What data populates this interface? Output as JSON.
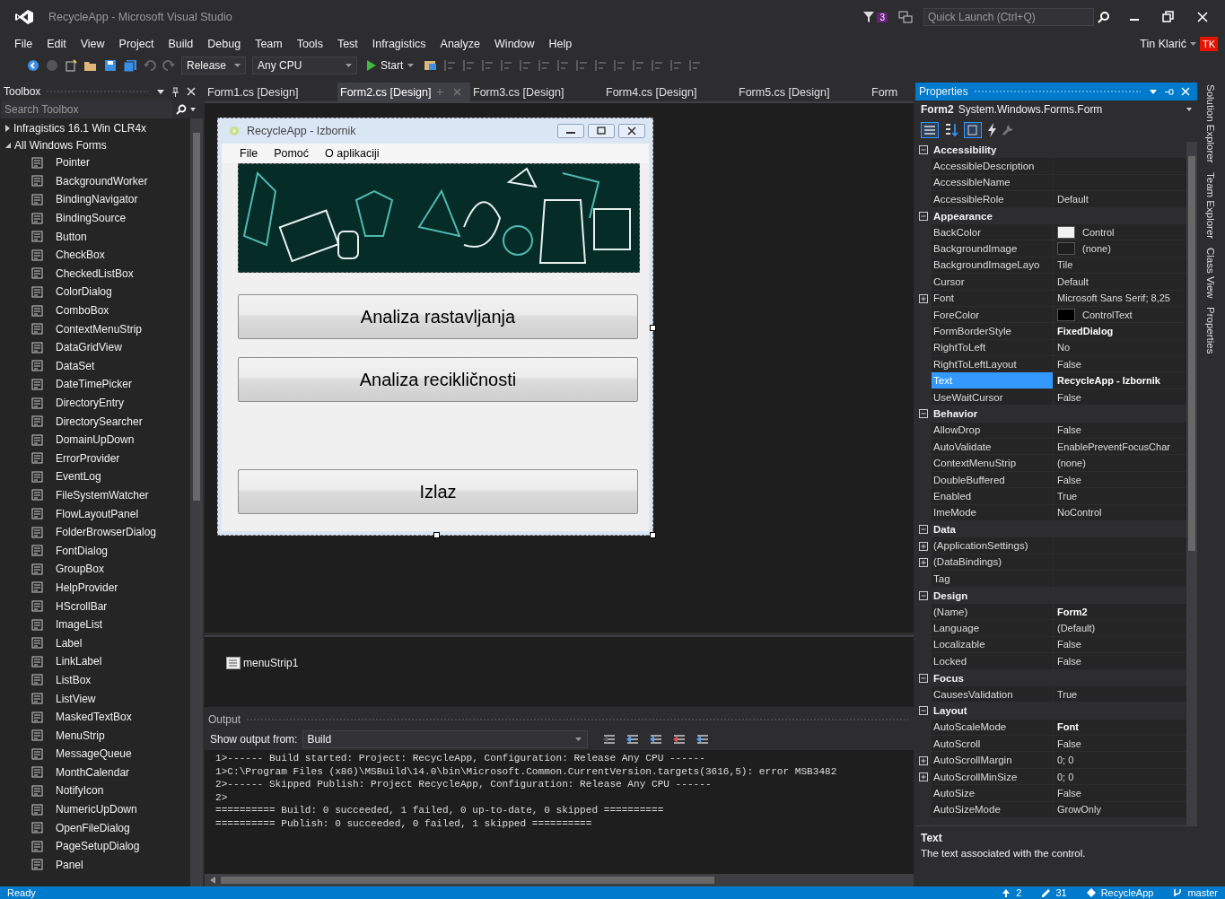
{
  "window": {
    "title": "RecycleApp - Microsoft Visual Studio",
    "notification_count": "3",
    "quick_launch": {
      "placeholder": "Quick Launch (Ctrl+Q)"
    },
    "user_name": "Tin Klarić",
    "user_initials": "TK"
  },
  "menu": [
    "File",
    "Edit",
    "View",
    "Project",
    "Build",
    "Debug",
    "Team",
    "Tools",
    "Test",
    "Infragistics",
    "Analyze",
    "Window",
    "Help"
  ],
  "toolbar": {
    "configuration": "Release",
    "platform": "Any CPU",
    "start": "Start"
  },
  "toolbox": {
    "title": "Toolbox",
    "search": {
      "placeholder": "Search Toolbox"
    },
    "groups": [
      {
        "label": "Infragistics 16.1 Win CLR4x",
        "expanded": false
      },
      {
        "label": "All Windows Forms",
        "expanded": true,
        "children": [
          "Pointer",
          "BackgroundWorker",
          "BindingNavigator",
          "BindingSource",
          "Button",
          "CheckBox",
          "CheckedListBox",
          "ColorDialog",
          "ComboBox",
          "ContextMenuStrip",
          "DataGridView",
          "DataSet",
          "DateTimePicker",
          "DirectoryEntry",
          "DirectorySearcher",
          "DomainUpDown",
          "ErrorProvider",
          "EventLog",
          "FileSystemWatcher",
          "FlowLayoutPanel",
          "FolderBrowserDialog",
          "FontDialog",
          "GroupBox",
          "HelpProvider",
          "HScrollBar",
          "ImageList",
          "Label",
          "LinkLabel",
          "ListBox",
          "ListView",
          "MaskedTextBox",
          "MenuStrip",
          "MessageQueue",
          "MonthCalendar",
          "NotifyIcon",
          "NumericUpDown",
          "OpenFileDialog",
          "PageSetupDialog",
          "Panel"
        ]
      }
    ]
  },
  "document_tabs": [
    {
      "label": "Form1.cs [Design]",
      "selected": false
    },
    {
      "label": "Form2.cs [Design]",
      "selected": true
    },
    {
      "label": "Form3.cs [Design]",
      "selected": false
    },
    {
      "label": "Form4.cs [Design]",
      "selected": false
    },
    {
      "label": "Form5.cs [Design]",
      "selected": false
    },
    {
      "label": "Form",
      "selected": false
    }
  ],
  "designer": {
    "form": {
      "title": "RecycleApp - Izbornik",
      "menu": [
        "File",
        "Pomoć",
        "O aplikaciji"
      ],
      "buttons": [
        "Analiza rastavljanja",
        "Analiza recikličnosti",
        "Izlaz"
      ]
    },
    "component_tray": [
      "menuStrip1"
    ]
  },
  "output": {
    "title": "Output",
    "source_label": "Show output from:",
    "source": "Build",
    "lines": [
      "1>------ Build started: Project: RecycleApp, Configuration: Release Any CPU ------",
      "1>C:\\Program Files (x86)\\MSBuild\\14.0\\bin\\Microsoft.Common.CurrentVersion.targets(3616,5): error MSB3482",
      "2>------ Skipped Publish: Project RecycleApp, Configuration: Release Any CPU ------",
      "2>",
      "========== Build: 0 succeeded, 1 failed, 0 up-to-date, 0 skipped ==========",
      "========== Publish: 0 succeeded, 0 failed, 1 skipped =========="
    ]
  },
  "properties": {
    "title": "Properties",
    "object_name": "Form2",
    "object_type": "System.Windows.Forms.Form",
    "categories": [
      {
        "name": "Accessibility",
        "expanded": true,
        "rows": [
          {
            "name": "AccessibleDescription",
            "selected": false
          },
          {
            "name": "AccessibleName",
            "selected": false
          },
          {
            "name": "AccessibleRole",
            "value": "Default",
            "selected": false
          }
        ]
      },
      {
        "name": "Appearance",
        "expanded": true,
        "rows": [
          {
            "name": "BackColor",
            "value": "Control",
            "color": "#f0f0f0",
            "selected": false
          },
          {
            "name": "BackgroundImage",
            "value": "(none)",
            "color": "#1e1e1e",
            "selected": false
          },
          {
            "name": "BackgroundImageLayo",
            "value": "Tile",
            "selected": false
          },
          {
            "name": "Cursor",
            "value": "Default",
            "selected": false
          },
          {
            "name": "Font",
            "value": "Microsoft Sans Serif; 8,25",
            "expanded": false,
            "selected": false
          },
          {
            "name": "ForeColor",
            "value": "ControlText",
            "color": "#000000",
            "selected": false
          },
          {
            "name": "FormBorderStyle",
            "value": "FixedDialog",
            "bold": true,
            "selected": false
          },
          {
            "name": "RightToLeft",
            "value": "No",
            "selected": false
          },
          {
            "name": "RightToLeftLayout",
            "value": "False",
            "selected": false
          },
          {
            "name": "Text",
            "value": "RecycleApp - Izbornik",
            "bold": true,
            "selected": true
          },
          {
            "name": "UseWaitCursor",
            "value": "False",
            "selected": false
          }
        ]
      },
      {
        "name": "Behavior",
        "expanded": true,
        "rows": [
          {
            "name": "AllowDrop",
            "value": "False",
            "selected": false
          },
          {
            "name": "AutoValidate",
            "value": "EnablePreventFocusChar",
            "selected": false
          },
          {
            "name": "ContextMenuStrip",
            "value": "(none)",
            "selected": false
          },
          {
            "name": "DoubleBuffered",
            "value": "False",
            "selected": false
          },
          {
            "name": "Enabled",
            "value": "True",
            "selected": false
          },
          {
            "name": "ImeMode",
            "value": "NoControl",
            "selected": false
          }
        ]
      },
      {
        "name": "Data",
        "expanded": true,
        "rows": [
          {
            "name": "(ApplicationSettings)",
            "expanded": false,
            "selected": false
          },
          {
            "name": "(DataBindings)",
            "expanded": false,
            "selected": false
          },
          {
            "name": "Tag",
            "selected": false
          }
        ]
      },
      {
        "name": "Design",
        "expanded": true,
        "rows": [
          {
            "name": "(Name)",
            "value": "Form2",
            "bold": true,
            "selected": false
          },
          {
            "name": "Language",
            "value": "(Default)",
            "selected": false
          },
          {
            "name": "Localizable",
            "value": "False",
            "selected": false
          },
          {
            "name": "Locked",
            "value": "False",
            "selected": false
          }
        ]
      },
      {
        "name": "Focus",
        "expanded": true,
        "rows": [
          {
            "name": "CausesValidation",
            "value": "True",
            "selected": false
          }
        ]
      },
      {
        "name": "Layout",
        "expanded": true,
        "rows": [
          {
            "name": "AutoScaleMode",
            "value": "Font",
            "bold": true,
            "selected": false
          },
          {
            "name": "AutoScroll",
            "value": "False",
            "selected": false
          },
          {
            "name": "AutoScrollMargin",
            "value": "0; 0",
            "expanded": false,
            "selected": false
          },
          {
            "name": "AutoScrollMinSize",
            "value": "0; 0",
            "expanded": false,
            "selected": false
          },
          {
            "name": "AutoSize",
            "value": "False",
            "selected": false
          },
          {
            "name": "AutoSizeMode",
            "value": "GrowOnly",
            "selected": false
          }
        ]
      }
    ],
    "description": {
      "title": "Text",
      "text": "The text associated with the control."
    }
  },
  "side_tabs": [
    "Solution Explorer",
    "Team Explorer",
    "Class View",
    "Properties"
  ],
  "status_bar": {
    "text": "Ready",
    "items": [
      {
        "kind": "push",
        "text": "2"
      },
      {
        "kind": "edits",
        "text": "31"
      },
      {
        "kind": "repo",
        "text": "RecycleApp"
      },
      {
        "kind": "branch",
        "text": "master"
      }
    ]
  }
}
